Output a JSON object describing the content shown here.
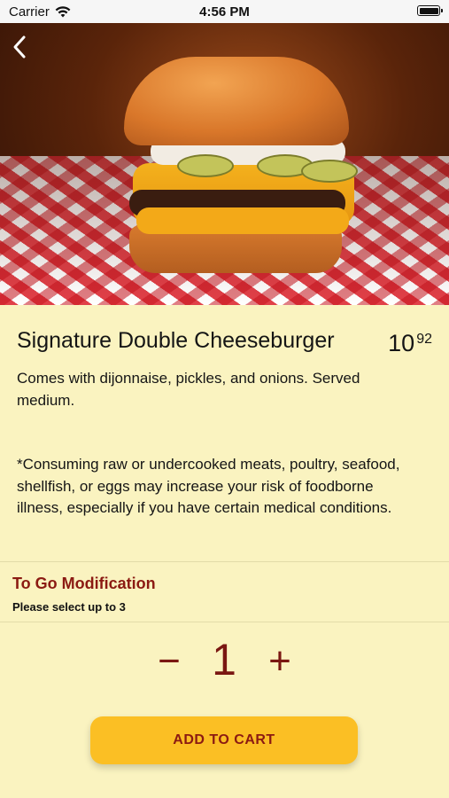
{
  "status_bar": {
    "carrier": "Carrier",
    "time": "4:56 PM"
  },
  "item": {
    "title": "Signature Double Cheeseburger",
    "price_dollars": "10",
    "price_cents": "92",
    "description": "Comes with dijonnaise, pickles, and onions. Served medium.",
    "warning": "*Consuming raw or undercooked meats, poultry, seafood, shellfish, or eggs may increase your risk of foodborne illness, especially if you have certain medical conditions."
  },
  "modification": {
    "title": "To Go Modification",
    "subtitle": "Please select up to 3"
  },
  "quantity": {
    "minus": "−",
    "value": "1",
    "plus": "+"
  },
  "cart": {
    "add_label": "ADD TO CART"
  },
  "colors": {
    "background": "#faf3c0",
    "accent": "#8b1a12",
    "button": "#fbbf24"
  }
}
